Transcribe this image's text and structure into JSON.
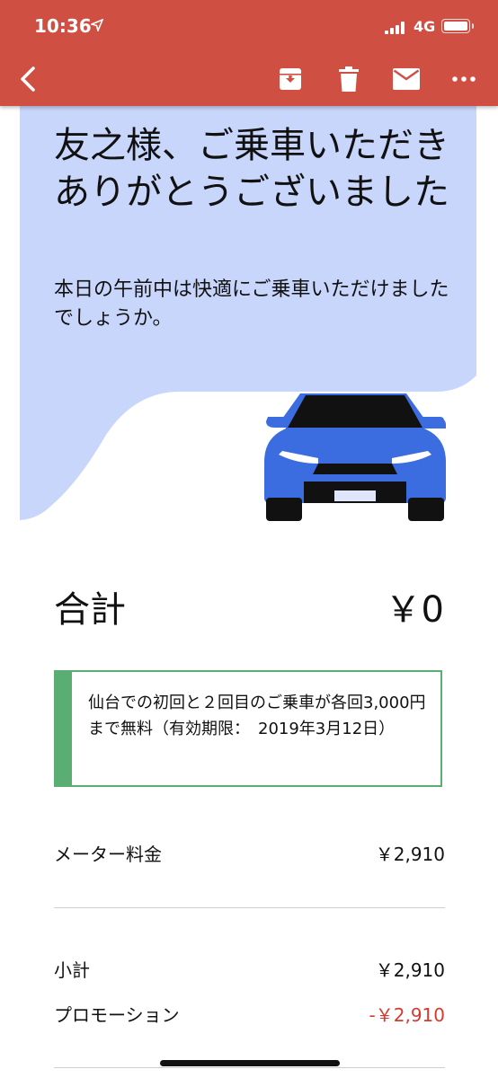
{
  "status_bar": {
    "time": "10:36",
    "location_icon": "location-arrow-icon",
    "network": "4G"
  },
  "toolbar": {
    "back_icon": "chevron-left-icon",
    "archive_icon": "archive-icon",
    "delete_icon": "trash-icon",
    "mail_icon": "mail-icon",
    "more_icon": "more-icon"
  },
  "hero": {
    "title": "友之様、ご乗車いただきありがとうございました",
    "subtitle": "本日の午前中は快適にご乗車いただけましたでしょうか。",
    "car_icon": "car-icon"
  },
  "total": {
    "label": "合計",
    "value": "￥0"
  },
  "promotion_notice": "仙台での初回と２回目のご乗車が各回3,000円まで無料（有効期限：　2019年3月12日）",
  "line_items": [
    {
      "label": "メーター料金",
      "value": "￥2,910"
    },
    {
      "label": "小計",
      "value": "￥2,910"
    },
    {
      "label": "プロモーション",
      "value": "-￥2,910"
    }
  ],
  "colors": {
    "header_red": "#cf4f42",
    "hero_blue": "#c8d6fb",
    "car_blue": "#3c6de0",
    "promo_green": "#5aae74",
    "negative_red": "#d33b2f"
  }
}
